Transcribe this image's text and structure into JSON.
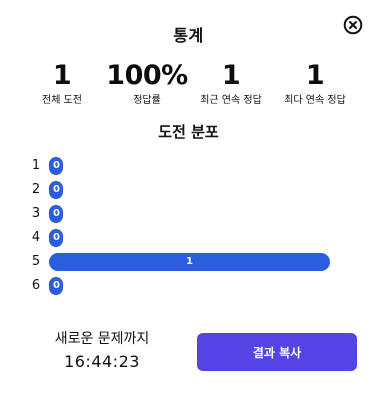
{
  "dialog": {
    "title": "통계",
    "close_icon": "close-circle-icon"
  },
  "stats": [
    {
      "value": "1",
      "label": "전체 도전"
    },
    {
      "value": "100%",
      "label": "정답률"
    },
    {
      "value": "1",
      "label": "최근 연속 정답"
    },
    {
      "value": "1",
      "label": "최다 연속 정답"
    }
  ],
  "distribution": {
    "title": "도전 분포",
    "rows": [
      {
        "guess": "1",
        "count": 0,
        "count_label": "0"
      },
      {
        "guess": "2",
        "count": 0,
        "count_label": "0"
      },
      {
        "guess": "3",
        "count": 0,
        "count_label": "0"
      },
      {
        "guess": "4",
        "count": 0,
        "count_label": "0"
      },
      {
        "guess": "5",
        "count": 1,
        "count_label": "1"
      },
      {
        "guess": "6",
        "count": 0,
        "count_label": "0"
      }
    ],
    "bar_color": "#2a5de0"
  },
  "footer": {
    "next_label": "새로운 문제까지",
    "countdown": "16:44:23",
    "share_label": "결과 복사",
    "share_color": "#5444e4"
  }
}
